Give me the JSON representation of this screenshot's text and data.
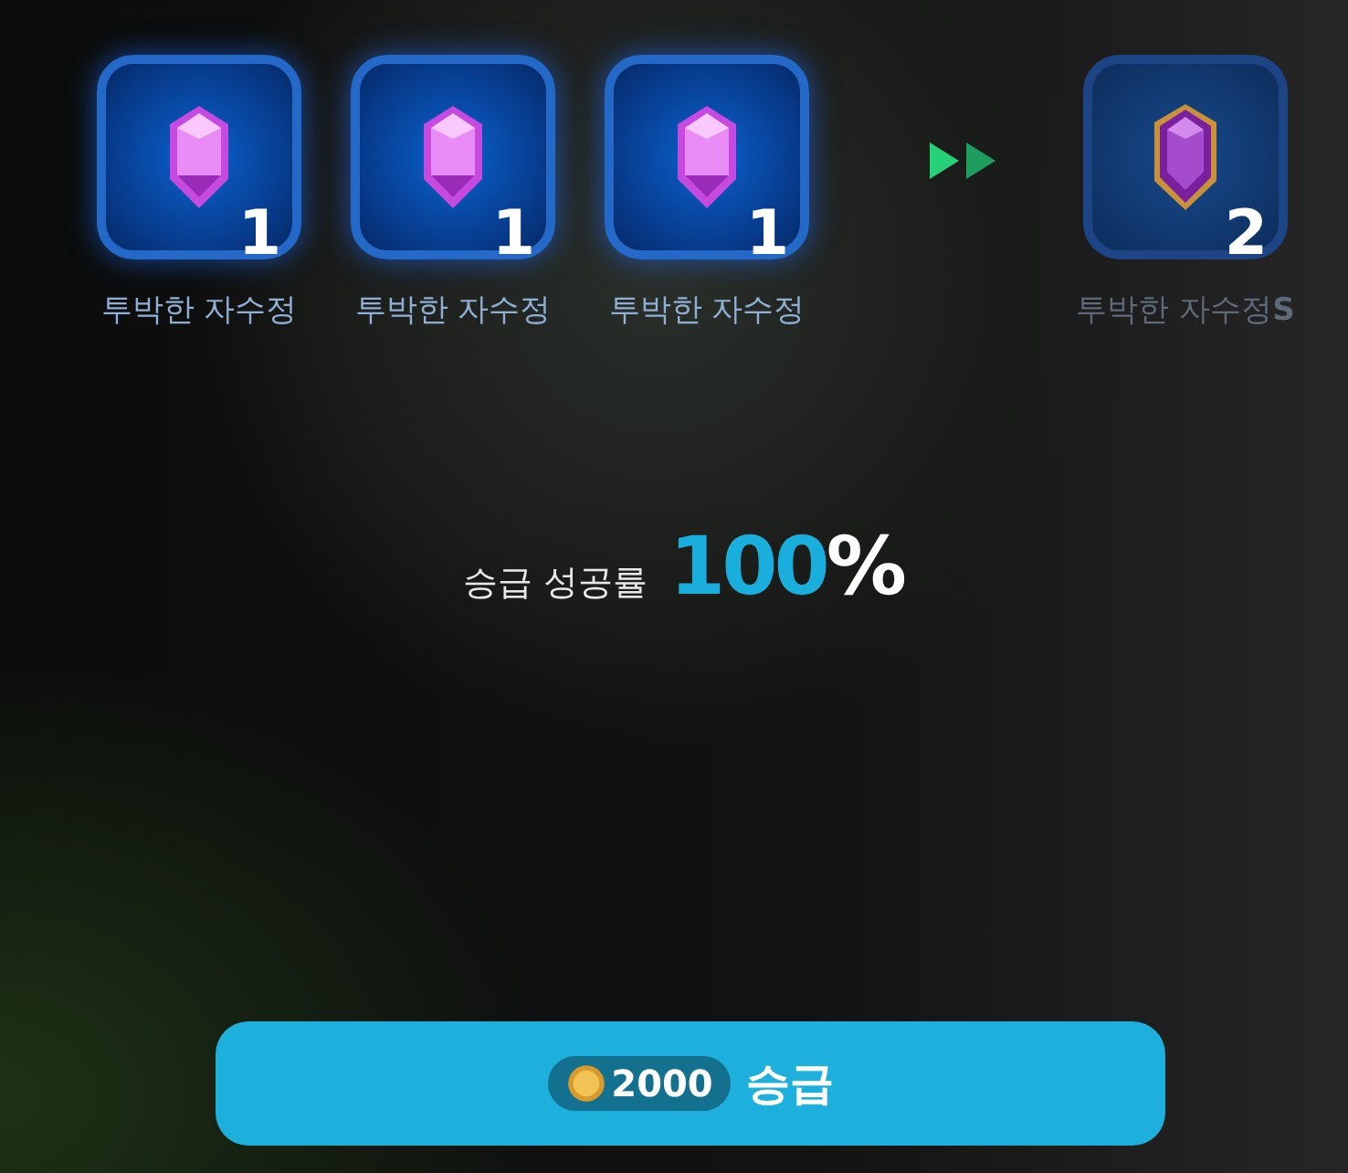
{
  "slots": [
    {
      "kind": "material",
      "quantity": "1",
      "label": "투박한 자수정"
    },
    {
      "kind": "material",
      "quantity": "1",
      "label": "투박한 자수정"
    },
    {
      "kind": "material",
      "quantity": "1",
      "label": "투박한 자수정"
    },
    {
      "kind": "result",
      "quantity": "2",
      "label": "투박한 자수정**S**"
    }
  ],
  "success_rate": {
    "label": "승급 성공률",
    "value": "100",
    "unit": "%"
  },
  "upgrade_button": {
    "cost": "2000",
    "label": "승급"
  }
}
